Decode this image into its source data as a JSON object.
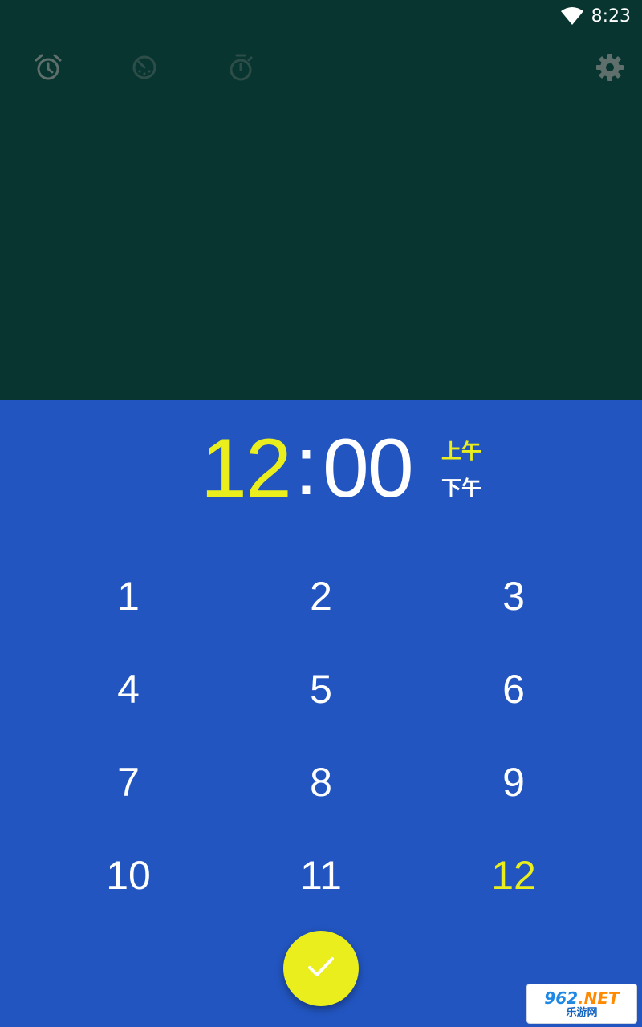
{
  "status_bar": {
    "time": "8:23",
    "wifi_icon": "wifi-icon"
  },
  "toolbar": {
    "tabs": [
      {
        "icon": "alarm-icon",
        "active": true
      },
      {
        "icon": "world-clock-icon",
        "active": false
      },
      {
        "icon": "stopwatch-icon",
        "active": false
      }
    ],
    "settings_icon": "gear-icon"
  },
  "time_picker": {
    "hours": "12",
    "separator": ":",
    "minutes": "00",
    "am_label": "上午",
    "pm_label": "下午",
    "selected_period": "am",
    "keys": [
      "1",
      "2",
      "3",
      "4",
      "5",
      "6",
      "7",
      "8",
      "9",
      "10",
      "11",
      "12"
    ],
    "selected_key": "12",
    "confirm_icon": "check-icon"
  },
  "watermark": {
    "logo_prefix": "962",
    "logo_suffix": ".NET",
    "subtitle": "乐游网"
  },
  "colors": {
    "top_background": "#083530",
    "picker_background": "#2255c0",
    "accent": "#e9ee1c",
    "text": "#ffffff",
    "icon_dim": "#5f6f6c"
  }
}
